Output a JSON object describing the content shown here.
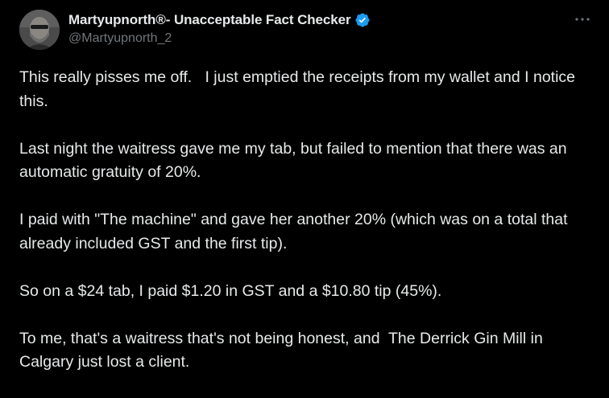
{
  "author": {
    "display_name": "Martyupnorth®- Unacceptable Fact Checker",
    "handle": "@Martyupnorth_2",
    "verified_icon": "verified-badge-icon",
    "avatar_icon": "avatar-photo"
  },
  "menu": {
    "more_icon": "more-horizontal-icon"
  },
  "post": {
    "paragraphs": [
      "This really pisses me off.   I just emptied the receipts from my wallet and I notice this.",
      "Last night the waitress gave me my tab, but failed to mention that there was an automatic gratuity of 20%.",
      "I paid with \"The machine\" and gave her another 20% (which was on a total that already included GST and the first tip).",
      "So on a $24 tab, I paid $1.20 in GST and a $10.80 tip (45%).",
      "To me, that's a waitress that's not being honest, and  The Derrick Gin Mill in Calgary just lost a client."
    ]
  },
  "colors": {
    "background": "#000000",
    "text_primary": "#e7e9ea",
    "text_secondary": "#71767b",
    "verified_blue": "#1d9bf0"
  }
}
